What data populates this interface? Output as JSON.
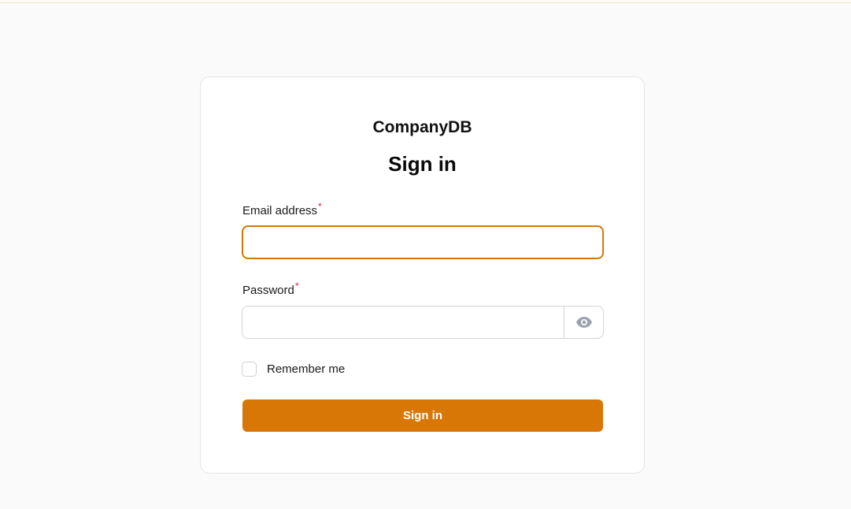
{
  "app": {
    "brand": "CompanyDB"
  },
  "form": {
    "heading": "Sign in",
    "email": {
      "label": "Email address",
      "required_mark": "*",
      "value": "",
      "placeholder": ""
    },
    "password": {
      "label": "Password",
      "required_mark": "*",
      "value": "",
      "placeholder": "",
      "toggle_icon": "eye-icon"
    },
    "remember": {
      "label": "Remember me",
      "checked": false
    },
    "submit_label": "Sign in"
  },
  "colors": {
    "accent": "#d97706",
    "required": "#dc2626",
    "background": "#fafafa"
  }
}
